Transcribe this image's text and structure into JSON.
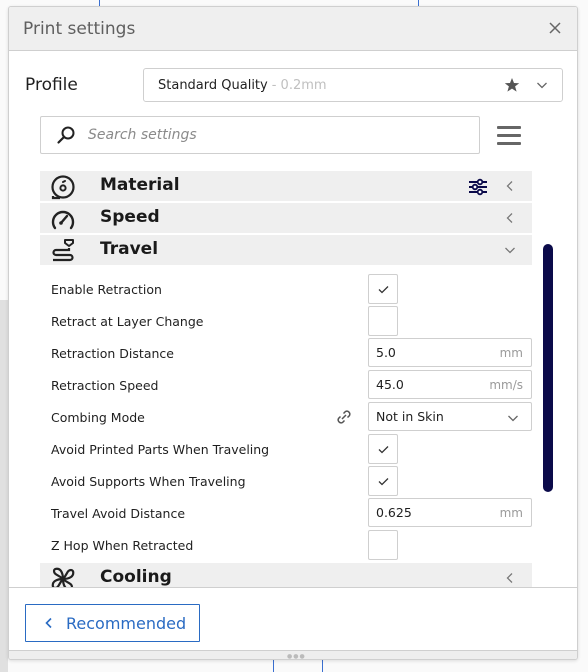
{
  "panel": {
    "title": "Print settings",
    "close_icon": "close-icon"
  },
  "profile": {
    "label": "Profile",
    "selected_name": "Standard Quality",
    "selected_detail": "- 0.2mm",
    "favorite_icon": "star-icon",
    "dropdown_icon": "chevron-down-icon"
  },
  "search": {
    "placeholder": "Search settings",
    "value": "",
    "icon": "search-icon"
  },
  "menu": {
    "icon": "hamburger-menu-icon"
  },
  "categories": {
    "material": {
      "label": "Material",
      "icon": "material-spool-icon",
      "extra_icon": "sliders-icon",
      "state": "collapsed"
    },
    "speed": {
      "label": "Speed",
      "icon": "speedometer-icon",
      "state": "collapsed"
    },
    "travel": {
      "label": "Travel",
      "icon": "travel-icon",
      "state": "expanded"
    },
    "cooling": {
      "label": "Cooling",
      "icon": "fan-icon",
      "state": "collapsed"
    }
  },
  "settings": [
    {
      "label": "Enable Retraction",
      "type": "checkbox",
      "checked": true
    },
    {
      "label": "Retract at Layer Change",
      "type": "checkbox",
      "checked": false
    },
    {
      "label": "Retraction Distance",
      "type": "number",
      "value": "5.0",
      "unit": "mm"
    },
    {
      "label": "Retraction Speed",
      "type": "number",
      "value": "45.0",
      "unit": "mm/s"
    },
    {
      "label": "Combing Mode",
      "type": "dropdown",
      "value": "Not in Skin",
      "linked_icon": "link-icon"
    },
    {
      "label": "Avoid Printed Parts When Traveling",
      "type": "checkbox",
      "checked": true
    },
    {
      "label": "Avoid Supports When Traveling",
      "type": "checkbox",
      "checked": true
    },
    {
      "label": "Travel Avoid Distance",
      "type": "number",
      "value": "0.625",
      "unit": "mm"
    },
    {
      "label": "Z Hop When Retracted",
      "type": "checkbox",
      "checked": false
    }
  ],
  "footer": {
    "recommended_label": "Recommended",
    "recommended_icon": "chevron-left-icon"
  },
  "colors": {
    "accent_blue": "#2a6bc3",
    "scrollbar": "#0b0a4a",
    "category_bg": "#efefef"
  }
}
